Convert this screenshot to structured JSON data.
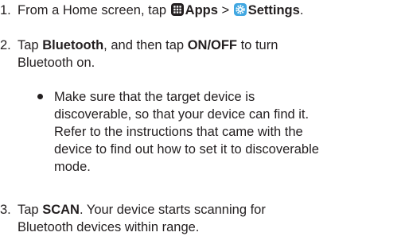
{
  "steps": [
    {
      "number": "1.",
      "pre": "From a Home screen, tap ",
      "apps_label": "Apps",
      "sep": " > ",
      "settings_label": "Settings",
      "post": "."
    },
    {
      "number": "2.",
      "line1_pre": "Tap ",
      "bluetooth_label": "Bluetooth",
      "line1_mid": ", and then tap ",
      "onoff_label": "ON/OFF",
      "line1_post": " to turn",
      "line2": "Bluetooth on."
    },
    {
      "number": "3.",
      "line1_pre": "Tap ",
      "scan_label": "SCAN",
      "line1_post": ". Your device starts scanning for",
      "line2": "Bluetooth devices within range."
    }
  ],
  "bullet": {
    "lines": [
      "Make sure that the target device is",
      "discoverable, so that your device can find it.",
      "Refer to the instructions that came with the",
      "device to find out how to set it to discoverable",
      "mode."
    ]
  },
  "colors": {
    "text": "#231f20",
    "apps_icon": "#231f20",
    "settings_icon_bg": "#41a7e1",
    "settings_icon_gear": "#ffffff"
  },
  "icons": {
    "apps": "apps-grid-icon",
    "settings": "settings-gear-icon"
  }
}
